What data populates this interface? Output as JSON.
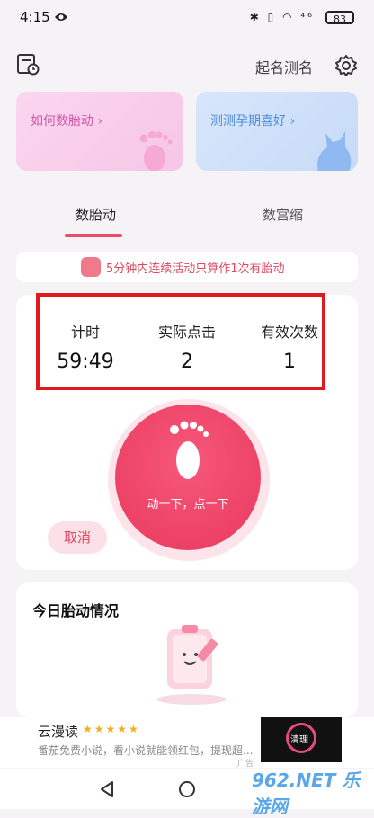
{
  "status_bar": {
    "time": "4:15",
    "indicators": "✱ ▯ ◠ ⁴⁶",
    "battery": "83"
  },
  "header": {
    "title": "起名测名",
    "calendar_icon": "calendar-clock-icon",
    "settings_icon": "gear-icon"
  },
  "cards": [
    {
      "label": "如何数胎动  ›",
      "icon": "footprint-icon",
      "color": "#fbd6ef"
    },
    {
      "label": "测测孕期喜好  ›",
      "icon": "cat-icon",
      "color": "#d7e6fb"
    }
  ],
  "tabs": [
    {
      "label": "数胎动",
      "active": true
    },
    {
      "label": "数宫缩",
      "active": false
    }
  ],
  "tip": {
    "text": "5分钟内连续活动只算作1次有胎动"
  },
  "stats": [
    {
      "label": "计时",
      "value": "59:49"
    },
    {
      "label": "实际点击",
      "value": "2"
    },
    {
      "label": "有效次数",
      "value": "1"
    }
  ],
  "main_button": {
    "label": "动一下，点一下",
    "icon": "footprint-icon"
  },
  "cancel_button": {
    "label": "取消"
  },
  "today": {
    "title": "今日胎动情况"
  },
  "ad": {
    "title": "云漫读",
    "stars": "★★★★★",
    "desc": "番茄免费小说，看小说就能领红包，提现超...",
    "tag": "广告",
    "thumb_label": "清理"
  },
  "watermark": "962.NET 乐游网",
  "colors": {
    "accent": "#ec4b6a",
    "highlight_box": "#e0191f"
  }
}
